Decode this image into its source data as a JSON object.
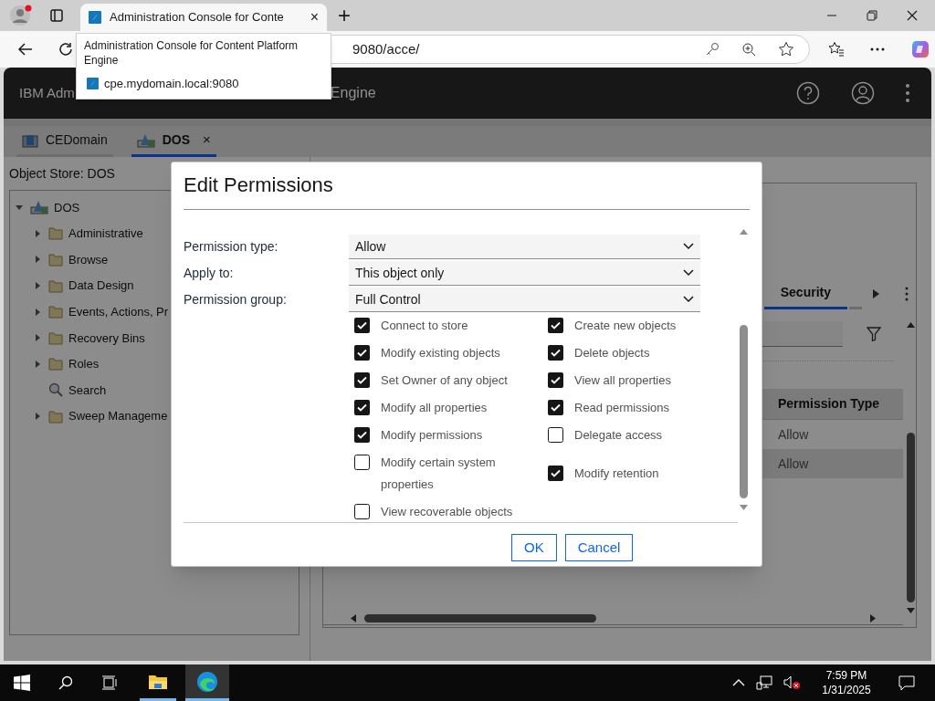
{
  "browser": {
    "tab": {
      "title": "Administration Console for Conte",
      "close": "×"
    },
    "new_tab": "+",
    "address": {
      "url_visible": "9080/acce/"
    },
    "tooltip": {
      "title": "Administration Console for Content Platform Engine",
      "url": "cpe.mydomain.local:9080"
    }
  },
  "app": {
    "title_left": "IBM Adm",
    "title_right": "Engine"
  },
  "tabs": [
    {
      "label": "CEDomain",
      "selected": false
    },
    {
      "label": "DOS",
      "selected": true,
      "close": "×"
    }
  ],
  "object_store": {
    "label": "Object Store: DOS",
    "tree": [
      {
        "label": "DOS",
        "kind": "store",
        "expanded": true,
        "children": [
          {
            "label": "Administrative",
            "kind": "folder",
            "expanded": false
          },
          {
            "label": "Browse",
            "kind": "folder",
            "expanded": false
          },
          {
            "label": "Data Design",
            "kind": "folder",
            "expanded": false
          },
          {
            "label": "Events, Actions, Pr",
            "kind": "folder",
            "expanded": false
          },
          {
            "label": "Recovery Bins",
            "kind": "folder",
            "expanded": false
          },
          {
            "label": "Roles",
            "kind": "folder",
            "expanded": false
          },
          {
            "label": "Search",
            "kind": "search"
          },
          {
            "label": "Sweep Manageme",
            "kind": "folder",
            "expanded": false
          }
        ]
      }
    ]
  },
  "right_panel": {
    "tabs": [
      {
        "label": "Security",
        "selected": true
      }
    ],
    "table": {
      "columns": [
        "Permission Type"
      ],
      "rows": [
        {
          "cells": [
            "Allow"
          ],
          "selected": false
        },
        {
          "cells": [
            "Allow"
          ],
          "selected": true
        }
      ]
    }
  },
  "dialog": {
    "title": "Edit Permissions",
    "fields": [
      {
        "label": "Permission type:",
        "value": "Allow"
      },
      {
        "label": "Apply to:",
        "value": "This object only"
      },
      {
        "label": "Permission group:",
        "value": "Full Control"
      }
    ],
    "permissions": [
      {
        "label": "Connect to store",
        "checked": true
      },
      {
        "label": "Create new objects",
        "checked": true
      },
      {
        "label": "Modify existing objects",
        "checked": true
      },
      {
        "label": "Delete objects",
        "checked": true
      },
      {
        "label": "Set Owner of any object",
        "checked": true
      },
      {
        "label": "View all properties",
        "checked": true
      },
      {
        "label": "Modify all properties",
        "checked": true
      },
      {
        "label": "Read permissions",
        "checked": true
      },
      {
        "label": "Modify permissions",
        "checked": true
      },
      {
        "label": "Delegate access",
        "checked": false
      },
      {
        "label": "Modify certain system properties",
        "checked": false
      },
      {
        "label": "Modify retention",
        "checked": true
      },
      {
        "label": "View recoverable objects",
        "checked": false
      }
    ],
    "buttons": [
      "OK",
      "Cancel"
    ]
  },
  "taskbar": {
    "time": "7:59 PM",
    "date": "1/31/2025"
  }
}
